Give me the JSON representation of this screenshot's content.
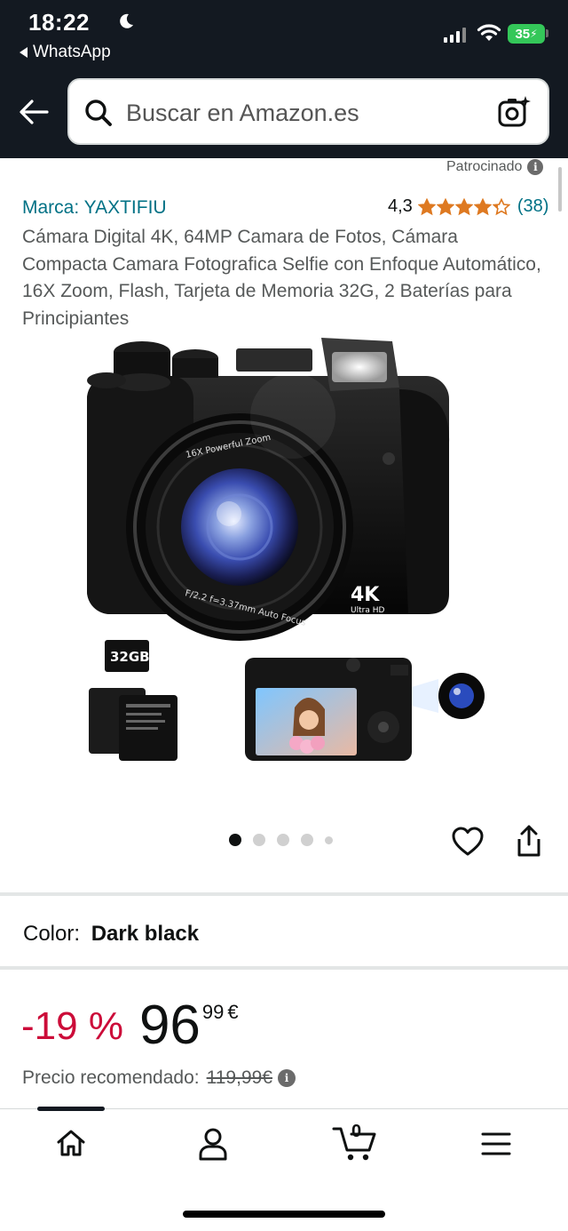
{
  "status_bar": {
    "time": "18:22",
    "back_app": "WhatsApp",
    "battery": "35"
  },
  "search": {
    "placeholder": "Buscar en Amazon.es",
    "icons": [
      "back-arrow-icon",
      "search-icon",
      "camera-lens-icon"
    ]
  },
  "product": {
    "sponsored": "Patrocinado",
    "brand": "Marca: YAXTIFIU",
    "rating": "4,3",
    "stars": 4.3,
    "rating_count": "(38)",
    "title": "Cámara Digital 4K, 64MP Camara de Fotos, Cámara Compacta Camara Fotografica Selfie con Enfoque Automático, 16X Zoom, Flash, Tarjeta de Memoria 32G, 2 Baterías para Principiantes",
    "image_total": 5,
    "image_active": 1,
    "image_labels": {
      "sd_card": "32GB",
      "lens_top": "16X Powerful Zoom",
      "lens_bottom": "F/2.2 f=3.37mm Auto Focus",
      "badge_4k": "4K",
      "badge_uhd": "Ultra HD"
    }
  },
  "color": {
    "label": "Color:",
    "value": "Dark black"
  },
  "price": {
    "discount": "-19 %",
    "whole": "96",
    "fraction": "99",
    "currency": "€",
    "rrp_label": "Precio recomendado:",
    "rrp_value": "119,99€"
  },
  "bottom_nav": {
    "cart_count": "0",
    "items": [
      "home-icon",
      "account-icon",
      "cart-icon",
      "menu-icon"
    ],
    "active": "home-icon"
  },
  "colors": {
    "header_bg": "#131921",
    "link": "#007185",
    "star": "#de7921",
    "discount": "#cc0c39"
  }
}
